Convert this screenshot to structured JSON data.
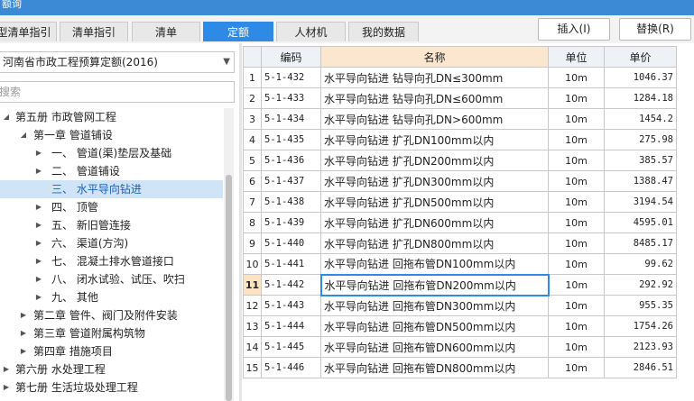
{
  "window": {
    "title": "额询"
  },
  "tabs": [
    {
      "label": "型清单指引",
      "active": false
    },
    {
      "label": "清单指引",
      "active": false
    },
    {
      "label": "清单",
      "active": false
    },
    {
      "label": "定额",
      "active": true
    },
    {
      "label": "人材机",
      "active": false
    },
    {
      "label": "我的数据",
      "active": false
    }
  ],
  "buttons": {
    "insert": "插入(I)",
    "replace": "替换(R)"
  },
  "left_panel": {
    "quota_book": "河南省市政工程预算定额(2016)",
    "search_placeholder": "搜索",
    "tree": [
      {
        "label": "第五册 市政管网工程",
        "toggle": "◢"
      },
      {
        "label": "第一章 管道铺设",
        "toggle": "◢"
      },
      {
        "label": "一、 管道(渠)垫层及基础",
        "toggle": "▶"
      },
      {
        "label": "二、 管道铺设",
        "toggle": "▶"
      },
      {
        "label": "三、 水平导向钻进",
        "toggle": "",
        "selected": true
      },
      {
        "label": "四、 顶管",
        "toggle": "▶"
      },
      {
        "label": "五、 新旧管连接",
        "toggle": "▶"
      },
      {
        "label": "六、 渠道(方沟)",
        "toggle": "▶"
      },
      {
        "label": "七、 混凝土排水管道接口",
        "toggle": "▶"
      },
      {
        "label": "八、 闭水试验、试压、吹扫",
        "toggle": "▶"
      },
      {
        "label": "九、 其他",
        "toggle": "▶"
      },
      {
        "label": "第二章 管件、阀门及附件安装",
        "toggle": "▶"
      },
      {
        "label": "第三章 管道附属构筑物",
        "toggle": "▶"
      },
      {
        "label": "第四章 措施项目",
        "toggle": "▶"
      },
      {
        "label": "第六册 水处理工程",
        "toggle": "▶"
      },
      {
        "label": "第七册 生活垃圾处理工程",
        "toggle": "▶"
      }
    ]
  },
  "table": {
    "headers": {
      "code": "编码",
      "name": "名称",
      "unit": "单位",
      "price": "单价"
    },
    "active_row": 11,
    "rows": [
      {
        "idx": "1",
        "code": "5-1-432",
        "name": "水平导向钻进 钻导向孔DN≤300mm",
        "unit": "10m",
        "price": "1046.37"
      },
      {
        "idx": "2",
        "code": "5-1-433",
        "name": "水平导向钻进 钻导向孔DN≤600mm",
        "unit": "10m",
        "price": "1284.18"
      },
      {
        "idx": "3",
        "code": "5-1-434",
        "name": "水平导向钻进 钻导向孔DN>600mm",
        "unit": "10m",
        "price": "1454.2"
      },
      {
        "idx": "4",
        "code": "5-1-435",
        "name": "水平导向钻进 扩孔DN100mm以内",
        "unit": "10m",
        "price": "275.98"
      },
      {
        "idx": "5",
        "code": "5-1-436",
        "name": "水平导向钻进 扩孔DN200mm以内",
        "unit": "10m",
        "price": "385.57"
      },
      {
        "idx": "6",
        "code": "5-1-437",
        "name": "水平导向钻进 扩孔DN300mm以内",
        "unit": "10m",
        "price": "1388.47"
      },
      {
        "idx": "7",
        "code": "5-1-438",
        "name": "水平导向钻进 扩孔DN500mm以内",
        "unit": "10m",
        "price": "3194.54"
      },
      {
        "idx": "8",
        "code": "5-1-439",
        "name": "水平导向钻进 扩孔DN600mm以内",
        "unit": "10m",
        "price": "4595.01"
      },
      {
        "idx": "9",
        "code": "5-1-440",
        "name": "水平导向钻进 扩孔DN800mm以内",
        "unit": "10m",
        "price": "8485.17"
      },
      {
        "idx": "10",
        "code": "5-1-441",
        "name": "水平导向钻进 回拖布管DN100mm以内",
        "unit": "10m",
        "price": "99.62"
      },
      {
        "idx": "11",
        "code": "5-1-442",
        "name": "水平导向钻进 回拖布管DN200mm以内",
        "unit": "10m",
        "price": "292.92"
      },
      {
        "idx": "12",
        "code": "5-1-443",
        "name": "水平导向钻进 回拖布管DN300mm以内",
        "unit": "10m",
        "price": "955.35"
      },
      {
        "idx": "13",
        "code": "5-1-444",
        "name": "水平导向钻进 回拖布管DN500mm以内",
        "unit": "10m",
        "price": "1754.26"
      },
      {
        "idx": "14",
        "code": "5-1-445",
        "name": "水平导向钻进 回拖布管DN600mm以内",
        "unit": "10m",
        "price": "2123.93"
      },
      {
        "idx": "15",
        "code": "5-1-446",
        "name": "水平导向钻进 回拖布管DN800mm以内",
        "unit": "10m",
        "price": "2846.51"
      }
    ]
  },
  "colors": {
    "accent": "#2d8ae6",
    "titlebar": "#3c8ad6",
    "selected_row": "#cfe4f7",
    "name_header": "#fbe6cf"
  }
}
